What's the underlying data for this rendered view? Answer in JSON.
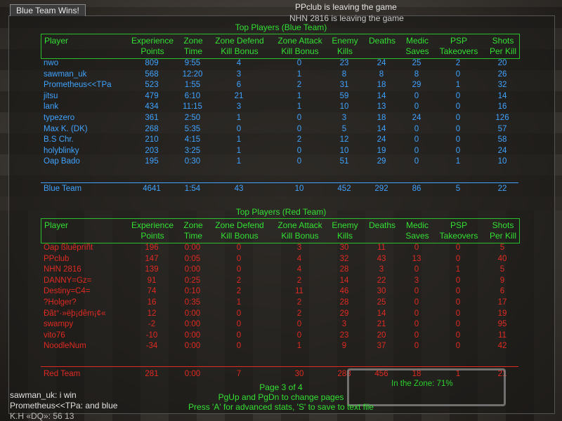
{
  "title": "Blue Team Wins!",
  "messages": [
    "PPclub is leaving the game",
    "NHN 2816 is leaving the game"
  ],
  "blue": {
    "section_title": "Top Players (Blue Team)",
    "rows": [
      [
        "nwo",
        "809",
        "9:55",
        "4",
        "0",
        "23",
        "24",
        "25",
        "2",
        "20"
      ],
      [
        "sawman_uk",
        "568",
        "12:20",
        "3",
        "1",
        "8",
        "8",
        "8",
        "0",
        "26"
      ],
      [
        "Prometheus<<TPa",
        "523",
        "1:55",
        "6",
        "2",
        "31",
        "18",
        "29",
        "1",
        "32"
      ],
      [
        "jitsu",
        "479",
        "6:10",
        "21",
        "1",
        "59",
        "14",
        "0",
        "0",
        "14"
      ],
      [
        "lank",
        "434",
        "11:15",
        "3",
        "1",
        "10",
        "13",
        "0",
        "0",
        "16"
      ],
      [
        "typezero",
        "361",
        "2:50",
        "1",
        "0",
        "3",
        "18",
        "24",
        "0",
        "126"
      ],
      [
        "Max K. (DK)",
        "268",
        "5:35",
        "0",
        "0",
        "5",
        "14",
        "0",
        "0",
        "57"
      ],
      [
        "B.S Chr.",
        "210",
        "4:15",
        "1",
        "2",
        "12",
        "24",
        "0",
        "0",
        "58"
      ],
      [
        "holyblinky",
        "203",
        "3:25",
        "1",
        "0",
        "10",
        "19",
        "0",
        "0",
        "24"
      ],
      [
        "Oap Bado",
        "195",
        "0:30",
        "1",
        "0",
        "51",
        "29",
        "0",
        "1",
        "10"
      ]
    ],
    "total": [
      "Blue Team",
      "4641",
      "1:54",
      "43",
      "10",
      "452",
      "292",
      "86",
      "5",
      "22"
    ]
  },
  "red": {
    "section_title": "Top Players (Red Team)",
    "rows": [
      [
        "Oap ßluêprïñt",
        "196",
        "0:00",
        "0",
        "3",
        "30",
        "11",
        "0",
        "0",
        "5"
      ],
      [
        " PPclub",
        "147",
        "0:05",
        "0",
        "4",
        "32",
        "43",
        "13",
        "0",
        "40"
      ],
      [
        "NHN 2816",
        "139",
        "0:00",
        "0",
        "4",
        "28",
        "3",
        "0",
        "1",
        "5"
      ],
      [
        "DANNY=Gz=",
        "91",
        "0:25",
        "2",
        "2",
        "14",
        "22",
        "3",
        "0",
        "9"
      ],
      [
        "Destiny=C4=",
        "74",
        "0:10",
        "2",
        "11",
        "46",
        "30",
        "0",
        "0",
        "6"
      ],
      [
        "?Holger?",
        "16",
        "0:35",
        "1",
        "2",
        "28",
        "25",
        "0",
        "0",
        "17"
      ],
      [
        "Ðãt°·»ëþ¡dêm¡¢«",
        "12",
        "0:00",
        "0",
        "2",
        "29",
        "14",
        "0",
        "0",
        "19"
      ],
      [
        "swampy",
        "-2",
        "0:00",
        "0",
        "0",
        "3",
        "21",
        "0",
        "0",
        "95"
      ],
      [
        "vito76",
        "-10",
        "0:00",
        "0",
        "0",
        "23",
        "20",
        "0",
        "0",
        "11"
      ],
      [
        "NoodleNum",
        "-34",
        "0:00",
        "0",
        "1",
        "9",
        "37",
        "0",
        "0",
        "42"
      ]
    ],
    "total": [
      "Red Team",
      "281",
      "0:00",
      "7",
      "30",
      "288",
      "456",
      "18",
      "1",
      "21"
    ]
  },
  "headers": [
    [
      "Player",
      ""
    ],
    [
      "Experience",
      "Points"
    ],
    [
      "Zone",
      "Time"
    ],
    [
      "Zone Defend",
      "Kill Bonus"
    ],
    [
      "Zone Attack",
      "Kill Bonus"
    ],
    [
      "Enemy",
      "Kills"
    ],
    [
      "Deaths",
      ""
    ],
    [
      "Medic",
      "Saves"
    ],
    [
      "PSP",
      "Takeovers"
    ],
    [
      "Shots",
      "Per Kill"
    ]
  ],
  "footer": {
    "page": "Page 3 of 4",
    "hint1": "PgUp and PgDn to change pages",
    "hint2": "Press 'A' for advanced stats, 'S' to save to text file"
  },
  "zone_text": "In the Zone: 71%",
  "chat": [
    "sawman_uk:  i win",
    "Prometheus<<TPa:  and blue",
    "K.H «DQ»:  56 13"
  ],
  "colors": {
    "blue": "#3fa3ff",
    "red": "#e02a22",
    "header": "#33e033"
  }
}
